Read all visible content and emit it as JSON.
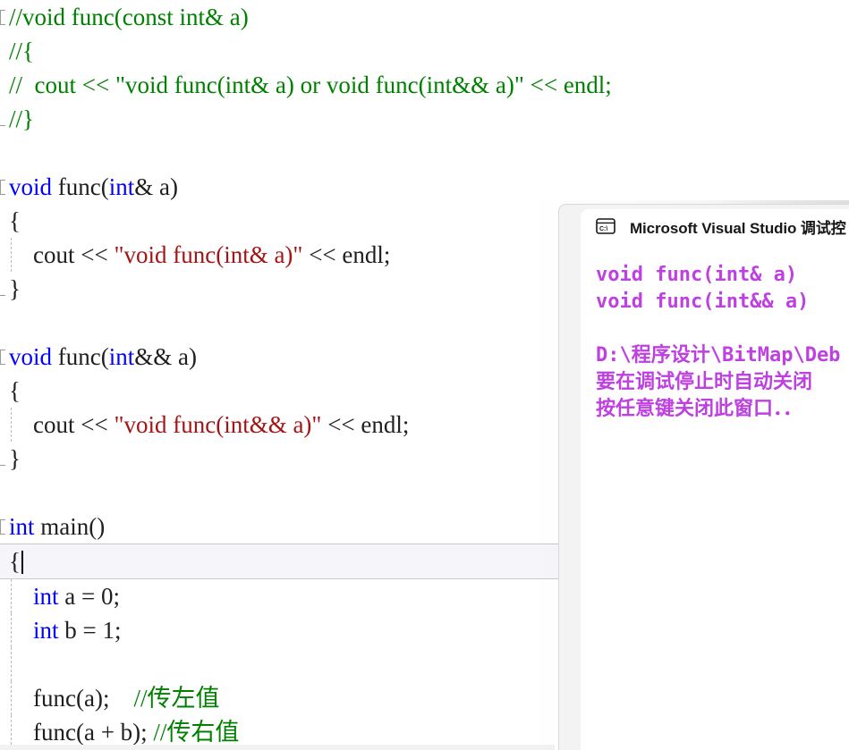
{
  "editor": {
    "name": "visual-studio-code-editor",
    "theme": {
      "background": "#ffffff",
      "comment": "#008000",
      "keyword": "#0000ff",
      "string": "#a31515",
      "plain": "#1f1f1f",
      "current_line_bg": "#f6f6fa",
      "current_line_border": "#c8c8d0"
    },
    "lines": [
      {
        "id": "l1",
        "outline": "start",
        "indent": false,
        "tokens": [
          {
            "t": "comment",
            "s": "//void func(const int& a)"
          }
        ]
      },
      {
        "id": "l2",
        "outline": "none",
        "indent": false,
        "tokens": [
          {
            "t": "comment",
            "s": "//{"
          }
        ]
      },
      {
        "id": "l3",
        "outline": "none",
        "indent": false,
        "tokens": [
          {
            "t": "comment",
            "s": "//  cout << \"void func(int& a) or void func(int&& a)\" << endl;"
          }
        ]
      },
      {
        "id": "l4",
        "outline": "end",
        "indent": false,
        "tokens": [
          {
            "t": "comment",
            "s": "//}"
          }
        ]
      },
      {
        "id": "l5",
        "outline": "none",
        "indent": false,
        "tokens": []
      },
      {
        "id": "l6",
        "outline": "start",
        "indent": false,
        "tokens": [
          {
            "t": "keyword",
            "s": "void"
          },
          {
            "t": "plain",
            "s": " func("
          },
          {
            "t": "keyword",
            "s": "int"
          },
          {
            "t": "plain",
            "s": "& a)"
          }
        ]
      },
      {
        "id": "l7",
        "outline": "none",
        "indent": false,
        "tokens": [
          {
            "t": "plain",
            "s": "{"
          }
        ]
      },
      {
        "id": "l8",
        "outline": "none",
        "indent": true,
        "tokens": [
          {
            "t": "plain",
            "s": "    cout << "
          },
          {
            "t": "string",
            "s": "\"void func(int& a)\""
          },
          {
            "t": "plain",
            "s": " << endl;"
          }
        ]
      },
      {
        "id": "l9",
        "outline": "end",
        "indent": false,
        "tokens": [
          {
            "t": "plain",
            "s": "}"
          }
        ]
      },
      {
        "id": "l10",
        "outline": "none",
        "indent": false,
        "tokens": []
      },
      {
        "id": "l11",
        "outline": "start",
        "indent": false,
        "tokens": [
          {
            "t": "keyword",
            "s": "void"
          },
          {
            "t": "plain",
            "s": " func("
          },
          {
            "t": "keyword",
            "s": "int"
          },
          {
            "t": "plain",
            "s": "&& a)"
          }
        ]
      },
      {
        "id": "l12",
        "outline": "none",
        "indent": false,
        "tokens": [
          {
            "t": "plain",
            "s": "{"
          }
        ]
      },
      {
        "id": "l13",
        "outline": "none",
        "indent": true,
        "tokens": [
          {
            "t": "plain",
            "s": "    cout << "
          },
          {
            "t": "string",
            "s": "\"void func(int&& a)\""
          },
          {
            "t": "plain",
            "s": " << endl;"
          }
        ]
      },
      {
        "id": "l14",
        "outline": "end",
        "indent": false,
        "tokens": [
          {
            "t": "plain",
            "s": "}"
          }
        ]
      },
      {
        "id": "l15",
        "outline": "none",
        "indent": false,
        "tokens": []
      },
      {
        "id": "l16",
        "outline": "start",
        "indent": false,
        "tokens": [
          {
            "t": "keyword",
            "s": "int"
          },
          {
            "t": "plain",
            "s": " main()"
          }
        ]
      },
      {
        "id": "l17",
        "outline": "none",
        "indent": false,
        "current": true,
        "caret": true,
        "tokens": [
          {
            "t": "plain",
            "s": "{"
          }
        ]
      },
      {
        "id": "l18",
        "outline": "none",
        "indent": true,
        "tokens": [
          {
            "t": "plain",
            "s": "    "
          },
          {
            "t": "keyword",
            "s": "int"
          },
          {
            "t": "plain",
            "s": " a = 0;"
          }
        ]
      },
      {
        "id": "l19",
        "outline": "none",
        "indent": true,
        "tokens": [
          {
            "t": "plain",
            "s": "    "
          },
          {
            "t": "keyword",
            "s": "int"
          },
          {
            "t": "plain",
            "s": " b = 1;"
          }
        ]
      },
      {
        "id": "l20",
        "outline": "none",
        "indent": true,
        "tokens": []
      },
      {
        "id": "l21",
        "outline": "none",
        "indent": true,
        "tokens": [
          {
            "t": "plain",
            "s": "    func(a);    "
          },
          {
            "t": "comment",
            "s": "//传左值"
          }
        ]
      },
      {
        "id": "l22",
        "outline": "none",
        "indent": true,
        "tokens": [
          {
            "t": "plain",
            "s": "    func(a + b); "
          },
          {
            "t": "comment",
            "s": "//传右值"
          }
        ]
      }
    ]
  },
  "console": {
    "name": "debug-console-window",
    "tab_icon": "command-prompt-icon",
    "title": "Microsoft Visual Studio 调试控",
    "text_color": "#bf40e0",
    "background": "#ffffff",
    "lines": [
      "void func(int& a)",
      "void func(int&& a)",
      "",
      "D:\\程序设计\\BitMap\\Deb",
      "要在调试停止时自动关闭",
      "按任意键关闭此窗口．．"
    ]
  }
}
